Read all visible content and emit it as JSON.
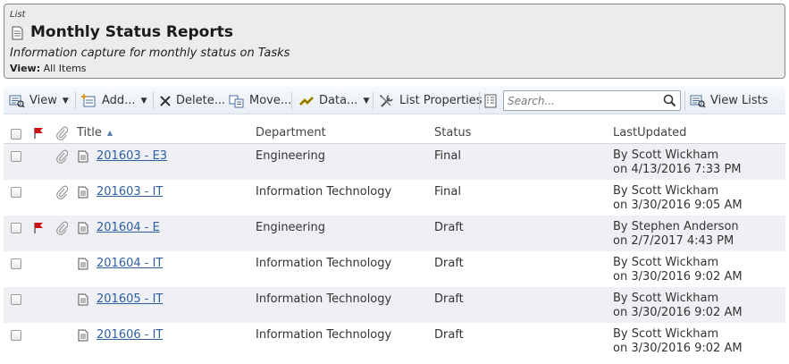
{
  "header": {
    "type_label": "List",
    "title": "Monthly Status Reports",
    "description": "Information capture for monthly status on Tasks",
    "view_label": "View:",
    "view_value": "All Items"
  },
  "toolbar": {
    "view_label": "View",
    "add_label": "Add...",
    "delete_label": "Delete...",
    "move_label": "Move...",
    "data_label": "Data...",
    "list_properties_label": "List Properties",
    "search_placeholder": "Search...",
    "view_lists_label": "View Lists"
  },
  "table": {
    "columns": {
      "title": "Title",
      "department": "Department",
      "status": "Status",
      "last_updated": "LastUpdated"
    },
    "rows": [
      {
        "title": "201603 - E3",
        "department": "Engineering",
        "status": "Final",
        "updated_by": "By Scott Wickham",
        "updated_on": "on 4/13/2016 7:33 PM",
        "flagged": false,
        "attachment": true
      },
      {
        "title": "201603 - IT",
        "department": "Information Technology",
        "status": "Final",
        "updated_by": "By Scott Wickham",
        "updated_on": "on 3/30/2016 9:05 AM",
        "flagged": false,
        "attachment": true
      },
      {
        "title": "201604 - E",
        "department": "Engineering",
        "status": "Draft",
        "updated_by": "By Stephen Anderson",
        "updated_on": "on 2/7/2017 4:43 PM",
        "flagged": true,
        "attachment": true
      },
      {
        "title": "201604 - IT",
        "department": "Information Technology",
        "status": "Draft",
        "updated_by": "By Scott Wickham",
        "updated_on": "on 3/30/2016 9:02 AM",
        "flagged": false,
        "attachment": false
      },
      {
        "title": "201605 - IT",
        "department": "Information Technology",
        "status": "Draft",
        "updated_by": "By Scott Wickham",
        "updated_on": "on 3/30/2016 9:02 AM",
        "flagged": false,
        "attachment": false
      },
      {
        "title": "201606 - IT",
        "department": "Information Technology",
        "status": "Draft",
        "updated_by": "By Scott Wickham",
        "updated_on": "on 3/30/2016 9:02 AM",
        "flagged": false,
        "attachment": false
      }
    ]
  },
  "colors": {
    "link": "#2f5f9e",
    "flag": "#cc1111",
    "alt_row": "#eef0f3"
  }
}
